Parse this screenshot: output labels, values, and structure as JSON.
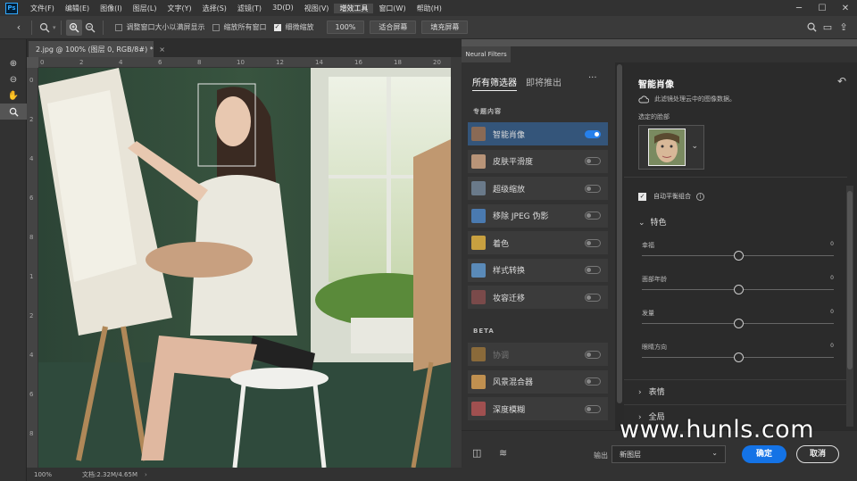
{
  "menu": {
    "logo": "Ps",
    "items": [
      "文件(F)",
      "编辑(E)",
      "图像(I)",
      "图层(L)",
      "文字(Y)",
      "选择(S)",
      "滤镜(T)",
      "3D(D)",
      "视图(V)",
      "增效工具",
      "窗口(W)",
      "帮助(H)"
    ],
    "active_index": 9
  },
  "options": {
    "resize_windows": "调整窗口大小以满屏显示",
    "zoom_all": "缩放所有窗口",
    "scrubby_zoom": "细微缩放",
    "zoom_value": "100%",
    "fit_screen": "适合屏幕",
    "fill_screen": "填充屏幕"
  },
  "document": {
    "tab_title": "2.jpg @ 100% (图层 0, RGB/8#) *",
    "tab_close": "×",
    "ruler_h": [
      "0",
      "2",
      "4",
      "6",
      "8",
      "10",
      "12",
      "14",
      "16",
      "18",
      "20"
    ],
    "ruler_v": [
      "0",
      "2",
      "4",
      "6",
      "8",
      "1",
      "2",
      "4",
      "6",
      "8"
    ],
    "zoom": "100%",
    "doc_info": "文档:2.32M/4.65M"
  },
  "neural": {
    "tab": "Neural Filters",
    "tabs": [
      "所有筛选器",
      "即将推出"
    ],
    "more": "···",
    "section_featured": "专题内容",
    "section_beta": "BETA",
    "filters": [
      {
        "label": "智能肖像",
        "on": true,
        "selected": true,
        "dim": false,
        "color": "#8a6a55"
      },
      {
        "label": "皮肤平滑度",
        "on": false,
        "selected": false,
        "dim": false,
        "color": "#b89478"
      },
      {
        "label": "超级缩放",
        "on": false,
        "selected": false,
        "dim": false,
        "color": "#6a7a8a"
      },
      {
        "label": "移除 JPEG 伪影",
        "on": false,
        "selected": false,
        "dim": false,
        "color": "#4a7ab0"
      },
      {
        "label": "着色",
        "on": false,
        "selected": false,
        "dim": false,
        "color": "#c8a040"
      },
      {
        "label": "样式转换",
        "on": false,
        "selected": false,
        "dim": false,
        "color": "#5a8ab8"
      },
      {
        "label": "妆容迁移",
        "on": false,
        "selected": false,
        "dim": false,
        "color": "#7a4a4a"
      }
    ],
    "beta_filters": [
      {
        "label": "协调",
        "on": false,
        "selected": false,
        "dim": true,
        "color": "#8a6a3a"
      },
      {
        "label": "风景混合器",
        "on": false,
        "selected": false,
        "dim": false,
        "color": "#c09050"
      },
      {
        "label": "深度模糊",
        "on": false,
        "selected": false,
        "dim": false,
        "color": "#a05050"
      }
    ],
    "detail": {
      "title": "智能肖像",
      "cloud_note": "此滤镜处理云中的图像数据。",
      "selected_face_label": "选定的脸部",
      "auto_balance": "自动平衡组合",
      "features_title": "特色",
      "sliders": [
        {
          "name": "幸福",
          "value": "0",
          "level": 0.5
        },
        {
          "name": "面部年龄",
          "value": "0",
          "level": 0.5
        },
        {
          "name": "发量",
          "value": "0",
          "level": 0.5
        },
        {
          "name": "眼睛方向",
          "value": "0",
          "level": 0.5
        }
      ],
      "sections": [
        "表情",
        "全局"
      ]
    },
    "output_label": "输出",
    "output_value": "新图层",
    "ok": "确定",
    "cancel": "取消"
  },
  "watermark": "www.hunls.com"
}
